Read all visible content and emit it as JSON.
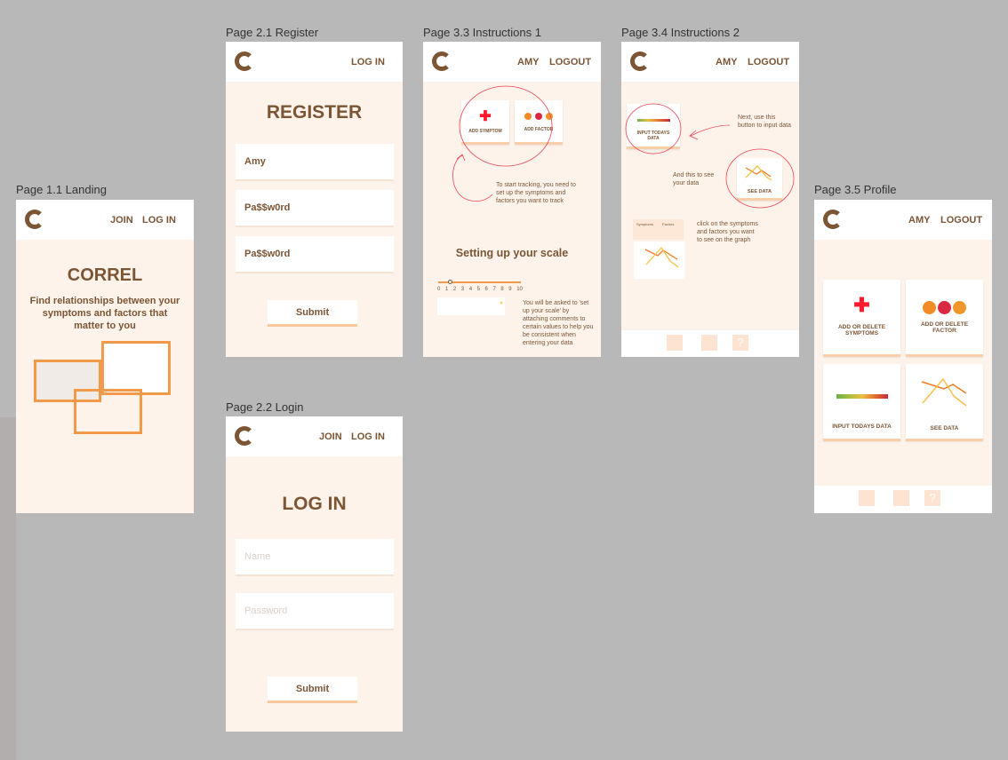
{
  "pages": {
    "landing": {
      "label": "Page 1.1 Landing",
      "nav": [
        "JOIN",
        "LOG IN"
      ],
      "title": "CORREL",
      "subtitle": "Find relationships between your symptoms and factors that matter to you"
    },
    "register": {
      "label": "Page 2.1 Register",
      "nav": [
        "LOG IN"
      ],
      "title": "REGISTER",
      "fields": [
        "Amy",
        "Pa$$w0rd",
        "Pa$$w0rd"
      ],
      "submit": "Submit"
    },
    "login": {
      "label": "Page 2.2  Login",
      "nav": [
        "JOIN",
        "LOG IN"
      ],
      "title": "LOG IN",
      "placeholders": [
        "Name",
        "Password"
      ],
      "submit": "Submit"
    },
    "instr1": {
      "label": "Page 3.3 Instructions 1",
      "nav": [
        "AMY",
        "LOGOUT"
      ],
      "add_symptom": "ADD SYMPTOM",
      "add_factor": "ADD FACTOR",
      "note1": "To start tracking, you need to set up the symptoms and factors you want to track",
      "scale_title": "Setting up your scale",
      "scale_ticks": [
        "0",
        "1",
        "2",
        "3",
        "4",
        "5",
        "6",
        "7",
        "8",
        "9",
        "10"
      ],
      "note2": "You will be asked to 'set up your scale' by attaching comments to certain values to help you be consistent when entering your data"
    },
    "instr2": {
      "label": "Page 3.4 Instructions 2",
      "nav": [
        "AMY",
        "LOGOUT"
      ],
      "input_data": "INPUT TODAYS DATA",
      "note1": "Next, use this button to input data",
      "note2": "And this to see your data",
      "see_data": "SEE DATA",
      "legend_symptoms": "Symptoms",
      "legend_factors": "Factors",
      "note3": "click on the symptoms and factors you want to see on the graph"
    },
    "profile": {
      "label": "Page 3.5 Profile",
      "nav": [
        "AMY",
        "LOGOUT"
      ],
      "cards": [
        "ADD OR DELETE SYMPTOMS",
        "ADD OR DELETE FACTOR",
        "INPUT TODAYS DATA",
        "SEE DATA"
      ]
    }
  },
  "colors": {
    "brand": "#7b5534",
    "page_bg": "#fdf3eb",
    "accent": "#f2994a",
    "annotation": "#ee4455",
    "plus": "#ff1a2e"
  },
  "icons": {
    "logo": "c-logo",
    "symptom": "plus-icon",
    "factors": [
      "food-icon",
      "sleep-icon",
      "exercise-icon"
    ],
    "nav": [
      "grid-icon",
      "chart-icon",
      "help-icon"
    ]
  }
}
